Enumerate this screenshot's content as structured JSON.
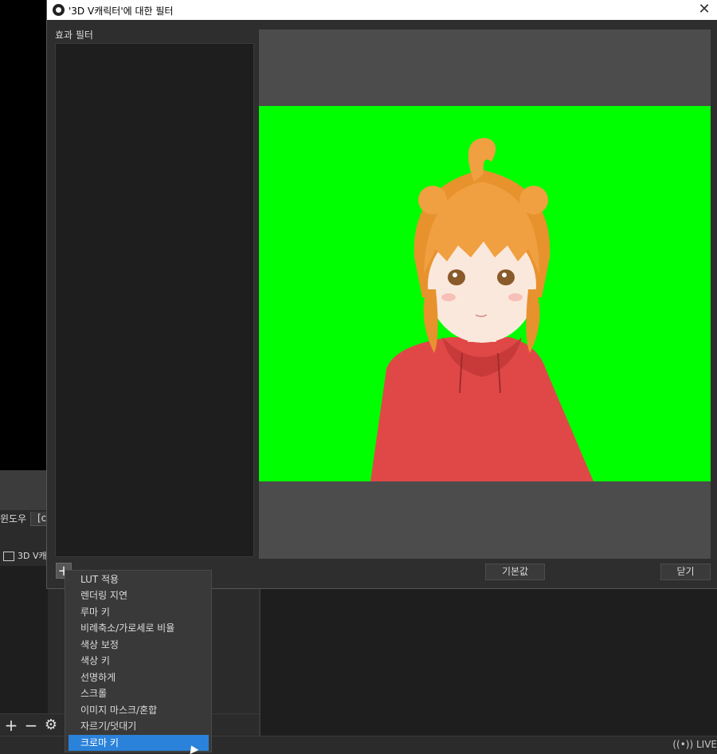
{
  "background": {
    "window_label": "윈도우",
    "window_select_value": "[c",
    "source_name": "3D V캐",
    "status_live": "LIVE"
  },
  "dialog": {
    "title": "'3D V캐릭터'에 대한 필터",
    "effect_filters_label": "효과 필터",
    "defaults_button": "기본값",
    "close_button": "닫기",
    "add_button": "+"
  },
  "menu": {
    "items": [
      "LUT 적용",
      "렌더링 지연",
      "루마 키",
      "비례축소/가로세로 비율",
      "색상 보정",
      "색상 키",
      "선명하게",
      "스크롤",
      "이미지 마스크/혼합",
      "자르기/덧대기",
      "크로마 키"
    ],
    "selected_index": 10
  },
  "colors": {
    "chroma_green": "#00ff00",
    "selection": "#2a82da",
    "hoodie": "#e04848",
    "hair": "#f0a040"
  }
}
